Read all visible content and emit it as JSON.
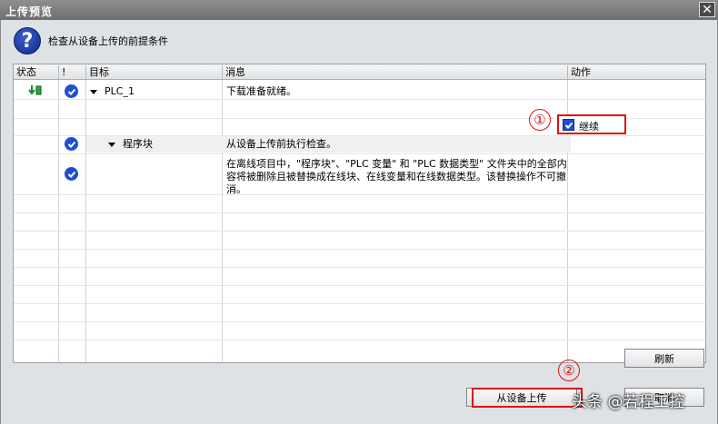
{
  "window": {
    "title": "上传预览",
    "close_glyph": "✕"
  },
  "header": {
    "message": "检查从设备上传的前提条件",
    "icon_glyph": "?"
  },
  "table": {
    "columns": [
      "状态",
      "!",
      "目标",
      "消息",
      "动作"
    ],
    "rows": [
      {
        "target": "PLC_1",
        "message": "下载准备就绪。"
      },
      {
        "target": "程序块",
        "message": "从设备上传前执行检查。",
        "action_label": "继续",
        "action_checked": true
      },
      {
        "message": "在离线项目中，\"程序块\"、\"PLC 变量\" 和 \"PLC 数据类型\" 文件夹中的全部内容将被删除且被替换成在线块、在线变量和在线数据类型。该替换操作不可撤消。"
      }
    ]
  },
  "annotations": {
    "one": "①",
    "two": "②"
  },
  "buttons": {
    "refresh": "刷新",
    "upload": "从设备上传",
    "cancel": "取消"
  },
  "watermark": "头条 @若程工控",
  "colors": {
    "check_blue": "#1f4fd0",
    "annotation_red": "#e01010"
  }
}
